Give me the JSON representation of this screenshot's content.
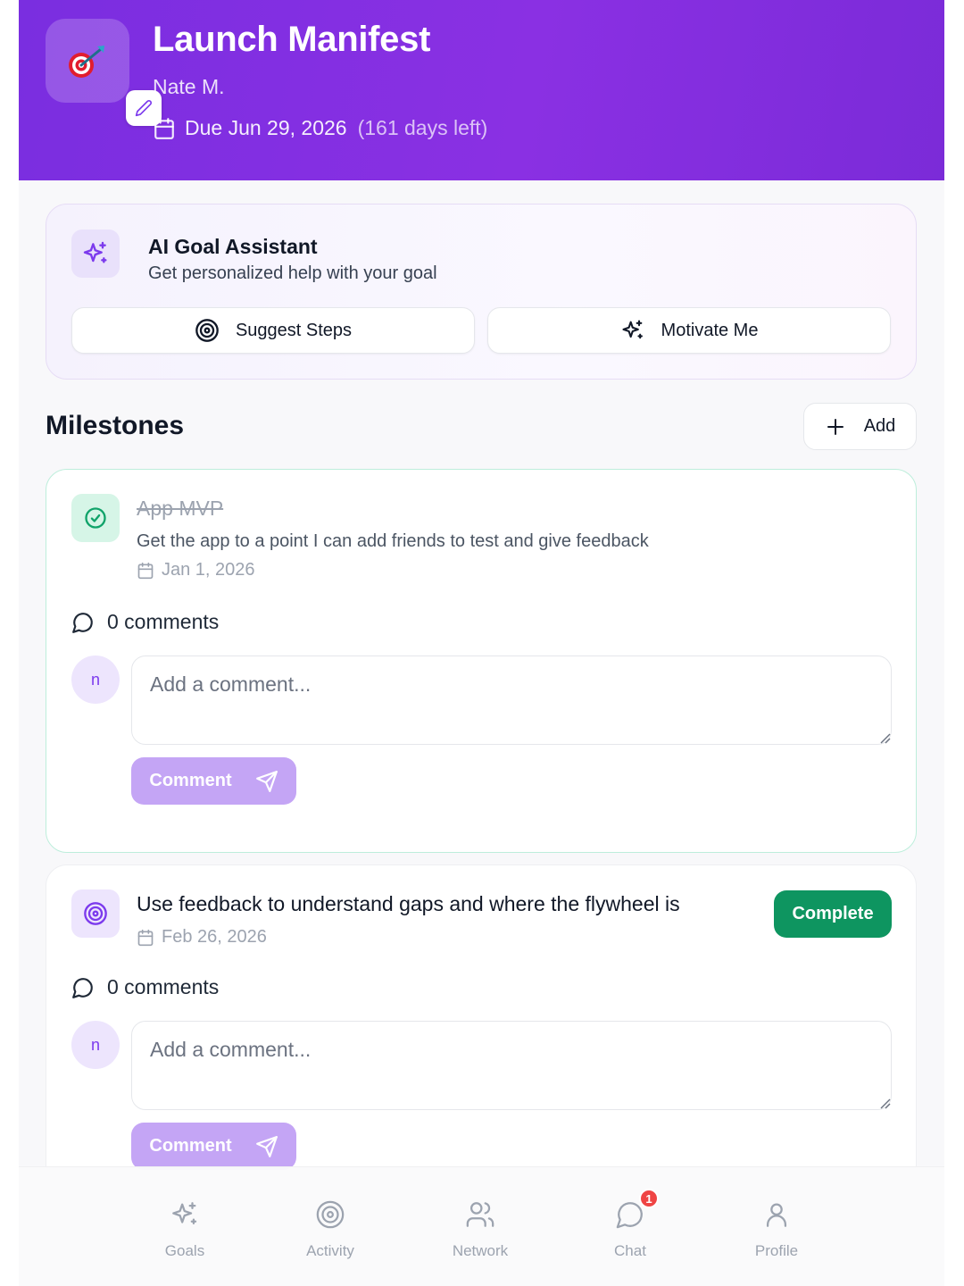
{
  "header": {
    "title": "Launch Manifest",
    "owner": "Nate M.",
    "due": "Due Jun 29, 2026",
    "days_left": "(161 days left)",
    "goal_icon": "dart-target-emoji"
  },
  "ai_assistant": {
    "title": "AI Goal Assistant",
    "subtitle": "Get personalized help with your goal",
    "suggest_label": "Suggest Steps",
    "motivate_label": "Motivate Me"
  },
  "milestones": {
    "heading": "Milestones",
    "add_label": "Add",
    "items": [
      {
        "title": "App MVP",
        "description": "Get the app to a point I can add friends to test and give feedback",
        "date": "Jan 1, 2026",
        "status": "completed",
        "comments_label": "0 comments",
        "user_initial": "n",
        "comment_placeholder": "Add a comment...",
        "comment_button": "Comment"
      },
      {
        "title": "Use feedback to understand gaps and where the flywheel is",
        "date": "Feb 26, 2026",
        "status": "open",
        "complete_label": "Complete",
        "comments_label": "0 comments",
        "user_initial": "n",
        "comment_placeholder": "Add a comment...",
        "comment_button": "Comment"
      }
    ]
  },
  "nav": {
    "items": [
      {
        "label": "Goals",
        "icon": "sparkles-icon"
      },
      {
        "label": "Activity",
        "icon": "target-icon"
      },
      {
        "label": "Network",
        "icon": "users-icon"
      },
      {
        "label": "Chat",
        "icon": "chat-icon",
        "badge": "1"
      },
      {
        "label": "Profile",
        "icon": "user-icon"
      }
    ]
  },
  "colors": {
    "header_purple": "#7a2ee0",
    "complete_green": "#0e9560",
    "comment_button": "#c4a5f5",
    "badge_red": "#ef4444"
  }
}
